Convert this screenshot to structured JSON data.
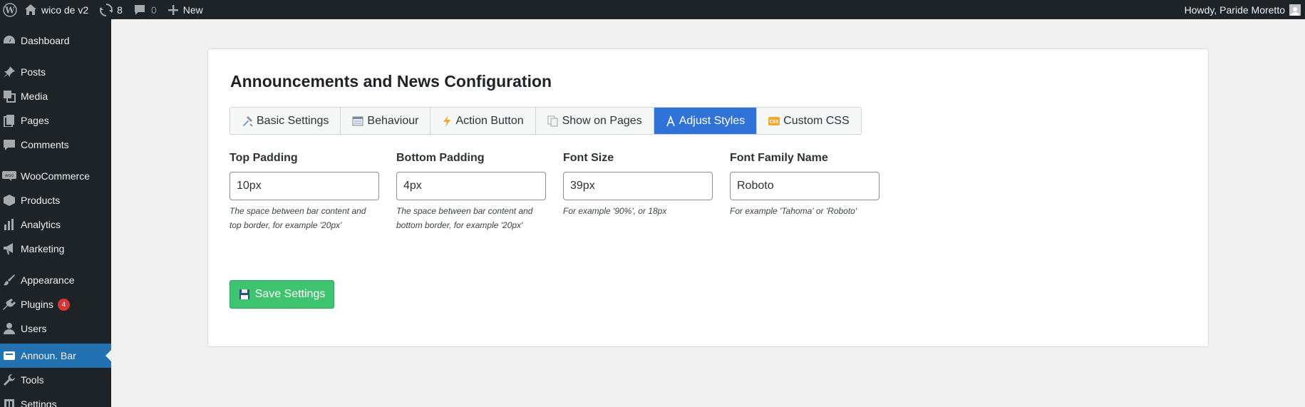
{
  "adminbar": {
    "site_name": "wico de v2",
    "updates_count": "8",
    "comments_count": "0",
    "new_label": "New",
    "greeting": "Howdy, Paride Moretto"
  },
  "sidebar": {
    "items": [
      {
        "label": "Dashboard",
        "icon": "dashboard-icon"
      },
      {
        "label": "Posts",
        "icon": "pin-icon"
      },
      {
        "label": "Media",
        "icon": "media-icon"
      },
      {
        "label": "Pages",
        "icon": "pages-icon"
      },
      {
        "label": "Comments",
        "icon": "comment-icon"
      },
      {
        "label": "WooCommerce",
        "icon": "woocommerce-icon"
      },
      {
        "label": "Products",
        "icon": "box-icon"
      },
      {
        "label": "Analytics",
        "icon": "bar-chart-icon"
      },
      {
        "label": "Marketing",
        "icon": "megaphone-icon"
      },
      {
        "label": "Appearance",
        "icon": "brush-icon"
      },
      {
        "label": "Plugins",
        "icon": "plug-icon",
        "badge": "4"
      },
      {
        "label": "Users",
        "icon": "user-icon"
      },
      {
        "label": "Announ. Bar",
        "icon": "announcement-icon",
        "current": true
      },
      {
        "label": "Tools",
        "icon": "wrench-icon"
      },
      {
        "label": "Settings",
        "icon": "settings-icon"
      }
    ]
  },
  "page": {
    "title": "Announcements and News Configuration"
  },
  "tabs": [
    {
      "label": "Basic Settings",
      "icon": "tools-icon"
    },
    {
      "label": "Behaviour",
      "icon": "window-icon"
    },
    {
      "label": "Action Button",
      "icon": "lightning-icon"
    },
    {
      "label": "Show on Pages",
      "icon": "copy-icon"
    },
    {
      "label": "Adjust Styles",
      "icon": "style-icon",
      "active": true
    },
    {
      "label": "Custom CSS",
      "icon": "css-icon"
    }
  ],
  "fields": {
    "top_padding": {
      "label": "Top Padding",
      "value": "10px",
      "help": "The space between bar content and top border, for example '20px'"
    },
    "bottom_padding": {
      "label": "Bottom Padding",
      "value": "4px",
      "help": "The space between bar content and bottom border, for example '20px'"
    },
    "font_size": {
      "label": "Font Size",
      "value": "39px",
      "help": "For example '90%', or 18px"
    },
    "font_family": {
      "label": "Font Family Name",
      "value": "Roboto",
      "help": "For example 'Tahoma' or 'Roboto'"
    }
  },
  "save_button": {
    "label": "Save Settings",
    "icon": "floppy-disk-icon"
  },
  "colors": {
    "sidebar_bg": "#1d2327",
    "current_menu": "#2271b1",
    "active_tab": "#2f73d9",
    "save_button": "#3ec36f",
    "badge": "#d63638"
  }
}
